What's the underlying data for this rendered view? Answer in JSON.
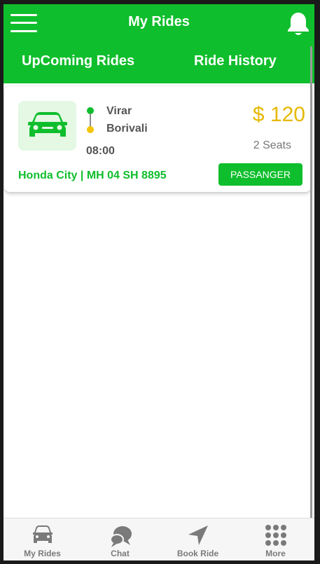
{
  "header": {
    "title": "My Rides",
    "menu_icon": "hamburger-menu-icon",
    "notification_icon": "bell-icon",
    "tabs": [
      {
        "label": "UpComing Rides"
      },
      {
        "label": "Ride History"
      }
    ]
  },
  "ride": {
    "vehicle_icon": "car-icon",
    "pickup": "Virar",
    "drop": "Borivali",
    "time": "08:00",
    "price": "$ 120",
    "seats": "2 Seats",
    "vehicle": "Honda City | MH 04 SH 8895",
    "role": "PASSANGER"
  },
  "bottom_nav": {
    "items": [
      {
        "label": "My Rides",
        "icon": "car-icon"
      },
      {
        "label": "Chat",
        "icon": "chat-bubbles-icon"
      },
      {
        "label": "Book Ride",
        "icon": "navigation-arrow-icon"
      },
      {
        "label": "More",
        "icon": "grid-dots-icon"
      }
    ]
  },
  "colors": {
    "brand_green": "#0fbe2c",
    "price_yellow": "#e6b800",
    "route_end_yellow": "#f5c400",
    "car_tile_bg": "#e4f8e4",
    "nav_gray": "#7a7a7a"
  }
}
